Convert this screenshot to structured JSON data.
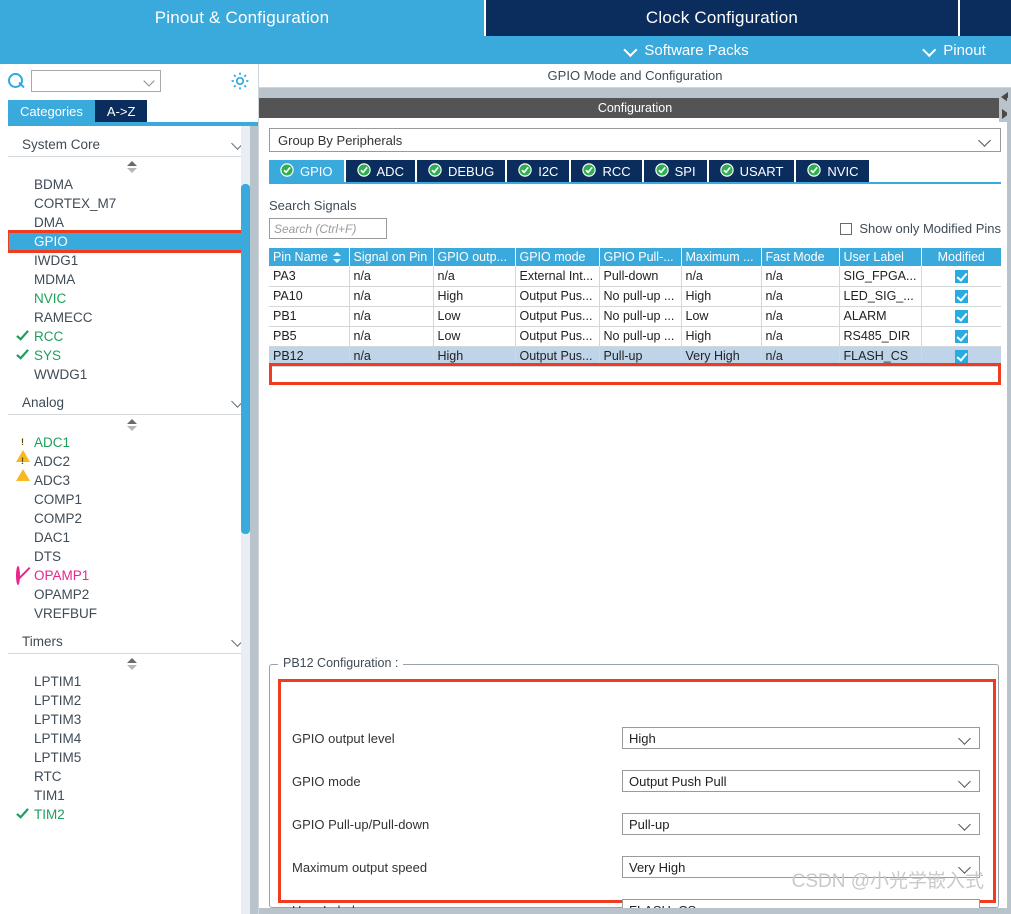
{
  "top_tabs": [
    {
      "label": "Pinout & Configuration",
      "active": true
    },
    {
      "label": "Clock Configuration",
      "active": false
    }
  ],
  "link_bar": {
    "software_packs": "Software Packs",
    "pinout": "Pinout"
  },
  "left_panel": {
    "search_value": "",
    "search_icon": "search-icon",
    "gear_icon": "gear-icon",
    "tabs": [
      {
        "label": "Categories",
        "active": true
      },
      {
        "label": "A->Z",
        "active": false
      }
    ],
    "sections": [
      {
        "title": "System Core",
        "items": [
          {
            "label": "BDMA",
            "state": "normal"
          },
          {
            "label": "CORTEX_M7",
            "state": "normal"
          },
          {
            "label": "DMA",
            "state": "normal"
          },
          {
            "label": "GPIO",
            "state": "selected"
          },
          {
            "label": "IWDG1",
            "state": "normal"
          },
          {
            "label": "MDMA",
            "state": "normal"
          },
          {
            "label": "NVIC",
            "state": "green"
          },
          {
            "label": "RAMECC",
            "state": "normal"
          },
          {
            "label": "RCC",
            "state": "green-check"
          },
          {
            "label": "SYS",
            "state": "green-check"
          },
          {
            "label": "WWDG1",
            "state": "normal"
          }
        ]
      },
      {
        "title": "Analog",
        "items": [
          {
            "label": "ADC1",
            "state": "warn-green"
          },
          {
            "label": "ADC2",
            "state": "warn"
          },
          {
            "label": "ADC3",
            "state": "normal"
          },
          {
            "label": "COMP1",
            "state": "normal"
          },
          {
            "label": "COMP2",
            "state": "normal"
          },
          {
            "label": "DAC1",
            "state": "normal"
          },
          {
            "label": "DTS",
            "state": "normal"
          },
          {
            "label": "OPAMP1",
            "state": "banned"
          },
          {
            "label": "OPAMP2",
            "state": "normal"
          },
          {
            "label": "VREFBUF",
            "state": "normal"
          }
        ]
      },
      {
        "title": "Timers",
        "items": [
          {
            "label": "LPTIM1",
            "state": "normal"
          },
          {
            "label": "LPTIM2",
            "state": "normal"
          },
          {
            "label": "LPTIM3",
            "state": "normal"
          },
          {
            "label": "LPTIM4",
            "state": "normal"
          },
          {
            "label": "LPTIM5",
            "state": "normal"
          },
          {
            "label": "RTC",
            "state": "normal"
          },
          {
            "label": "TIM1",
            "state": "normal"
          },
          {
            "label": "TIM2",
            "state": "green-check"
          }
        ]
      }
    ]
  },
  "right_panel": {
    "mode_header": "GPIO Mode and Configuration",
    "configuration_bar": "Configuration",
    "group_by": "Group By Peripherals",
    "peripheral_tabs": [
      {
        "label": "GPIO",
        "active": true
      },
      {
        "label": "ADC",
        "active": false
      },
      {
        "label": "DEBUG",
        "active": false
      },
      {
        "label": "I2C",
        "active": false
      },
      {
        "label": "RCC",
        "active": false
      },
      {
        "label": "SPI",
        "active": false
      },
      {
        "label": "USART",
        "active": false
      },
      {
        "label": "NVIC",
        "active": false
      }
    ],
    "search_signals_label": "Search Signals",
    "search_signals_placeholder": "Search (Ctrl+F)",
    "show_only_modified_pins": "Show only Modified Pins",
    "show_only_modified_checked": false,
    "table": {
      "columns": [
        "Pin Name",
        "Signal on Pin",
        "GPIO outp...",
        "GPIO mode",
        "GPIO Pull-...",
        "Maximum ...",
        "Fast Mode",
        "User Label",
        "Modified"
      ],
      "rows": [
        {
          "selected": false,
          "cells": [
            "PA3",
            "n/a",
            "n/a",
            "External Int...",
            "Pull-down",
            "n/a",
            "n/a",
            "SIG_FPGA..."
          ],
          "modified": true
        },
        {
          "selected": false,
          "cells": [
            "PA10",
            "n/a",
            "High",
            "Output Pus...",
            "No pull-up ...",
            "High",
            "n/a",
            "LED_SIG_..."
          ],
          "modified": true
        },
        {
          "selected": false,
          "cells": [
            "PB1",
            "n/a",
            "Low",
            "Output Pus...",
            "No pull-up ...",
            "Low",
            "n/a",
            "ALARM"
          ],
          "modified": true
        },
        {
          "selected": false,
          "cells": [
            "PB5",
            "n/a",
            "Low",
            "Output Pus...",
            "No pull-up ...",
            "High",
            "n/a",
            "RS485_DIR"
          ],
          "modified": true
        },
        {
          "selected": true,
          "cells": [
            "PB12",
            "n/a",
            "High",
            "Output Pus...",
            "Pull-up",
            "Very High",
            "n/a",
            "FLASH_CS"
          ],
          "modified": true
        }
      ]
    },
    "config_group": {
      "legend": "PB12 Configuration :",
      "fields": [
        {
          "label": "GPIO output level",
          "value": "High",
          "type": "select"
        },
        {
          "label": "GPIO mode",
          "value": "Output Push Pull",
          "type": "select"
        },
        {
          "label": "GPIO Pull-up/Pull-down",
          "value": "Pull-up",
          "type": "select"
        },
        {
          "label": "Maximum output speed",
          "value": "Very High",
          "type": "select"
        },
        {
          "label": "User Label",
          "value": "FLASH_CS",
          "type": "text"
        }
      ]
    },
    "watermark": "CSDN @小光学嵌入式"
  },
  "colors": {
    "accent_blue": "#3aa9dc",
    "navy": "#0a2d5e",
    "highlight_red": "#ef3b1f",
    "green": "#1ea05a",
    "pink": "#e8268c",
    "warn_yellow": "#f7b920",
    "selected_row": "#bfd4e8"
  }
}
